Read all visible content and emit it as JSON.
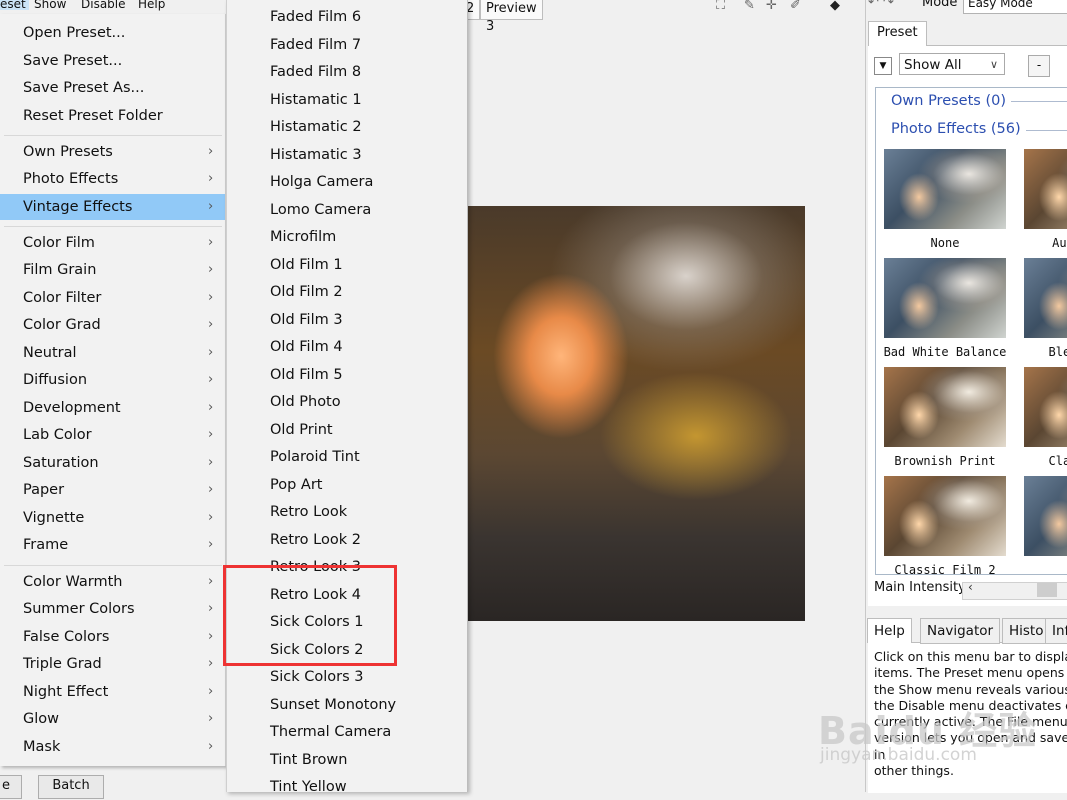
{
  "menubar": {
    "items": [
      "eset",
      "Show",
      "Disable",
      "Help"
    ]
  },
  "preview_tabs": [
    "2",
    "Preview 3"
  ],
  "menu": {
    "items": [
      {
        "label": "Open Preset...",
        "submenu": false
      },
      {
        "label": "Save Preset...",
        "submenu": false
      },
      {
        "label": "Save Preset As...",
        "submenu": false
      },
      {
        "label": "Reset Preset Folder",
        "submenu": false
      },
      {
        "label": "Own Presets",
        "submenu": true
      },
      {
        "label": "Photo Effects",
        "submenu": true
      },
      {
        "label": "Vintage Effects",
        "submenu": true,
        "highlighted": true
      },
      {
        "label": "Color Film",
        "submenu": true
      },
      {
        "label": "Film Grain",
        "submenu": true
      },
      {
        "label": "Color Filter",
        "submenu": true
      },
      {
        "label": "Color Grad",
        "submenu": true
      },
      {
        "label": "Neutral",
        "submenu": true
      },
      {
        "label": "Diffusion",
        "submenu": true
      },
      {
        "label": "Development",
        "submenu": true
      },
      {
        "label": "Lab Color",
        "submenu": true
      },
      {
        "label": "Saturation",
        "submenu": true
      },
      {
        "label": "Paper",
        "submenu": true
      },
      {
        "label": "Vignette",
        "submenu": true
      },
      {
        "label": "Frame",
        "submenu": true
      },
      {
        "label": "Color Warmth",
        "submenu": true
      },
      {
        "label": "Summer Colors",
        "submenu": true
      },
      {
        "label": "False Colors",
        "submenu": true
      },
      {
        "label": "Triple Grad",
        "submenu": true
      },
      {
        "label": "Night Effect",
        "submenu": true
      },
      {
        "label": "Glow",
        "submenu": true
      },
      {
        "label": "Mask",
        "submenu": true
      }
    ],
    "arrow": "›"
  },
  "submenu": {
    "items": [
      "Faded Film 6",
      "Faded Film 7",
      "Faded Film 8",
      "Histamatic 1",
      "Histamatic 2",
      "Histamatic 3",
      "Holga Camera",
      "Lomo Camera",
      "Microfilm",
      "Old Film 1",
      "Old Film 2",
      "Old Film 3",
      "Old Film 4",
      "Old Film 5",
      "Old Photo",
      "Old Print",
      "Polaroid Tint",
      "Pop Art",
      "Retro Look",
      "Retro Look 2",
      "Retro Look 3",
      "Retro Look 4",
      "Sick Colors 1",
      "Sick Colors 2",
      "Sick Colors 3",
      "Sunset Monotony",
      "Thermal Camera",
      "Tint Brown",
      "Tint Yellow"
    ]
  },
  "bottom_buttons": [
    "e",
    "Batch"
  ],
  "right_panel": {
    "mode_label": "Mode",
    "mode_value": "Easy Mode",
    "preset_tab": "Preset",
    "show_select": "Show All",
    "minus_label": "-",
    "groups": [
      "Own Presets (0)",
      "Photo Effects (56)"
    ],
    "thumbnails": [
      "None",
      "Aut",
      "Bad White Balance",
      "Blea",
      "Brownish Print",
      "Clas",
      "Classic Film 2",
      ""
    ],
    "intensity_label": "Main Intensity",
    "help_tabs": [
      "Help",
      "Navigator",
      "Histo",
      "Inf"
    ],
    "help_text": "Click on this menu bar to display\nitems. The Preset menu opens ar\nthe Show menu reveals various e\nthe Disable menu deactivates eff\ncurrently active. The File menu o\nversion lets you open and save in\nother things."
  },
  "watermark": {
    "main": "Baidu 经验",
    "sub": "jingyan.baidu.com"
  },
  "colors": {
    "highlight": "#91c9f7",
    "red_box": "#ee3333",
    "group_link": "#2c4fb0"
  }
}
